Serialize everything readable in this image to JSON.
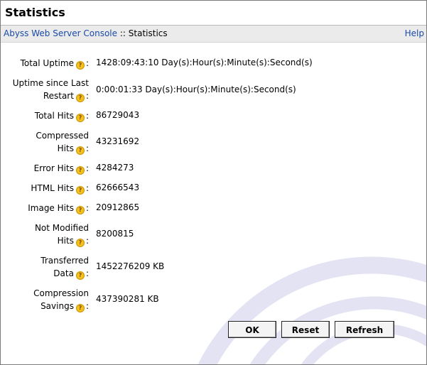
{
  "window": {
    "title": "Statistics"
  },
  "breadcrumb": {
    "home": "Abyss Web Server Console",
    "separator": "::",
    "current": "Statistics"
  },
  "help_label": "Help",
  "help_icon": "question-mark",
  "stats": [
    {
      "label": [
        "Total Uptime"
      ],
      "value": "1428:09:43:10 Day(s):Hour(s):Minute(s):Second(s)"
    },
    {
      "label": [
        "Uptime since Last",
        "Restart"
      ],
      "value": "0:00:01:33 Day(s):Hour(s):Minute(s):Second(s)"
    },
    {
      "label": [
        "Total Hits"
      ],
      "value": "86729043"
    },
    {
      "label": [
        "Compressed",
        "Hits"
      ],
      "value": "43231692"
    },
    {
      "label": [
        "Error Hits"
      ],
      "value": "4284273"
    },
    {
      "label": [
        "HTML Hits"
      ],
      "value": "62666543"
    },
    {
      "label": [
        "Image Hits"
      ],
      "value": "20912865"
    },
    {
      "label": [
        "Not Modified",
        "Hits"
      ],
      "value": "8200815"
    },
    {
      "label": [
        "Transferred",
        "Data"
      ],
      "value": "1452276209 KB"
    },
    {
      "label": [
        "Compression",
        "Savings"
      ],
      "value": "437390281 KB"
    }
  ],
  "buttons": {
    "ok": "OK",
    "reset": "Reset",
    "refresh": "Refresh"
  },
  "colors": {
    "link": "#1a4aa8",
    "swirl": "#e3e3f3",
    "help_icon": "#f4c01e"
  }
}
